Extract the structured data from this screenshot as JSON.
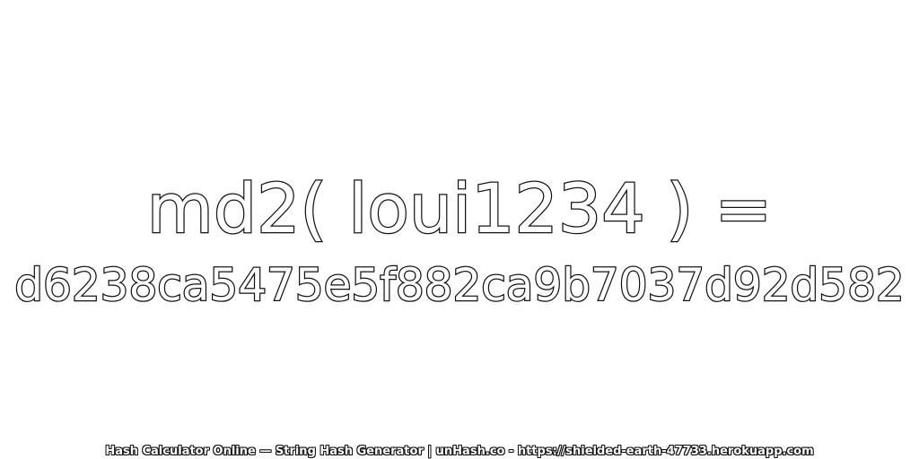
{
  "expression": "md2( loui1234 ) =",
  "hash_value": "d6238ca5475e5f882ca9b7037d92d582",
  "footer_text": "Hash Calculator Online — String Hash Generator | unHash.co - https://shielded-earth-47733.herokuapp.com",
  "colors": {
    "background": "#ffffff",
    "outline": "#111111",
    "fill": "#ffffff"
  }
}
